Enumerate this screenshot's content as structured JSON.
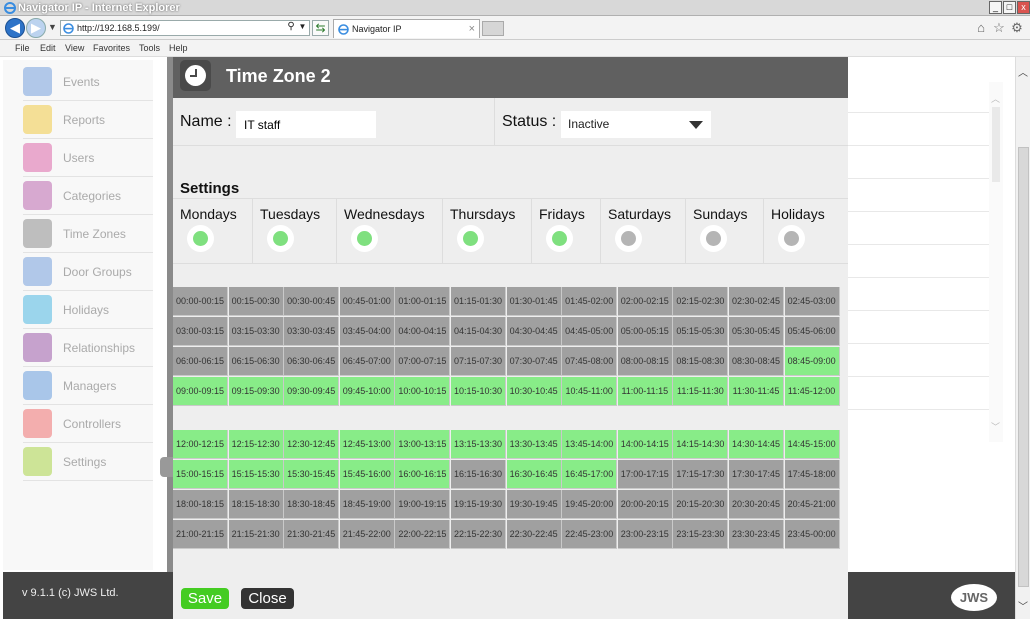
{
  "browser": {
    "window_title": "Navigator IP - Internet Explorer",
    "address": "http://192.168.5.199/",
    "tab_title": "Navigator IP",
    "menu": [
      "File",
      "Edit",
      "View",
      "Favorites",
      "Tools",
      "Help"
    ]
  },
  "sidebar": {
    "items": [
      {
        "label": "Events",
        "color": "#5a8fd8"
      },
      {
        "label": "Reports",
        "color": "#f0c020"
      },
      {
        "label": "Users",
        "color": "#d84a9a"
      },
      {
        "label": "Categories",
        "color": "#b04aa0"
      },
      {
        "label": "Time Zones",
        "color": "#777777"
      },
      {
        "label": "Door Groups",
        "color": "#5a8fd8"
      },
      {
        "label": "Holidays",
        "color": "#2aaadd"
      },
      {
        "label": "Relationships",
        "color": "#8a3a9a"
      },
      {
        "label": "Managers",
        "color": "#4a8ad8"
      },
      {
        "label": "Controllers",
        "color": "#ee5555"
      },
      {
        "label": "Settings",
        "color": "#99cc22"
      }
    ]
  },
  "footer": {
    "version": "v 9.1.1 (c) JWS Ltd.",
    "logo": "JWS"
  },
  "modal": {
    "title": "Time Zone 2",
    "name_label": "Name :",
    "name_value": "IT staff",
    "status_label": "Status :",
    "status_value": "Inactive",
    "settings_label": "Settings",
    "days": [
      {
        "label": "Mondays",
        "on": true
      },
      {
        "label": "Tuesdays",
        "on": true
      },
      {
        "label": "Wednesdays",
        "on": true
      },
      {
        "label": "Thursdays",
        "on": true
      },
      {
        "label": "Fridays",
        "on": true
      },
      {
        "label": "Saturdays",
        "on": false
      },
      {
        "label": "Sundays",
        "on": false
      },
      {
        "label": "Holidays",
        "on": false
      }
    ],
    "time_slots": {
      "row_start_hours": [
        0,
        3,
        6,
        9,
        12,
        15,
        18,
        21
      ],
      "active_slots": [
        "08:45-09:00",
        "09:00-09:15",
        "09:15-09:30",
        "09:30-09:45",
        "09:45-10:00",
        "10:00-10:15",
        "10:15-10:30",
        "10:30-10:45",
        "10:45-11:00",
        "11:00-11:15",
        "11:15-11:30",
        "11:30-11:45",
        "11:45-12:00",
        "12:00-12:15",
        "12:15-12:30",
        "12:30-12:45",
        "12:45-13:00",
        "13:00-13:15",
        "13:15-13:30",
        "13:30-13:45",
        "13:45-14:00",
        "14:00-14:15",
        "14:15-14:30",
        "14:30-14:45",
        "14:45-15:00",
        "15:00-15:15",
        "15:15-15:30",
        "15:30-15:45",
        "15:45-16:00",
        "16:00-16:15",
        "16:30-16:45",
        "16:45-17:00"
      ],
      "colors": {
        "active": "#88ec88",
        "inactive": "#a0a0a0"
      }
    },
    "save_label": "Save",
    "close_label": "Close"
  }
}
